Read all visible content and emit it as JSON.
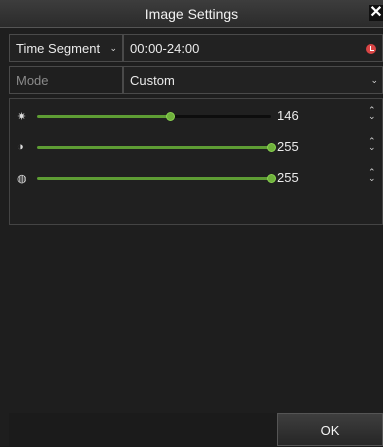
{
  "window": {
    "title": "Image Settings",
    "close_label": "✕"
  },
  "time_segment": {
    "label": "Time Segment",
    "value": "00:00-24:00"
  },
  "mode": {
    "label": "Mode",
    "value": "Custom"
  },
  "sliders": [
    {
      "name": "brightness",
      "icon": "sun-icon",
      "value": "146",
      "level": 0.57
    },
    {
      "name": "contrast",
      "icon": "contrast-icon",
      "value": "255",
      "level": 1.0
    },
    {
      "name": "saturation",
      "icon": "saturation-icon",
      "value": "255",
      "level": 1.0
    }
  ],
  "footer": {
    "ok_label": "OK"
  },
  "colors": {
    "accent": "#5e9d34",
    "clock": "#d94545"
  }
}
